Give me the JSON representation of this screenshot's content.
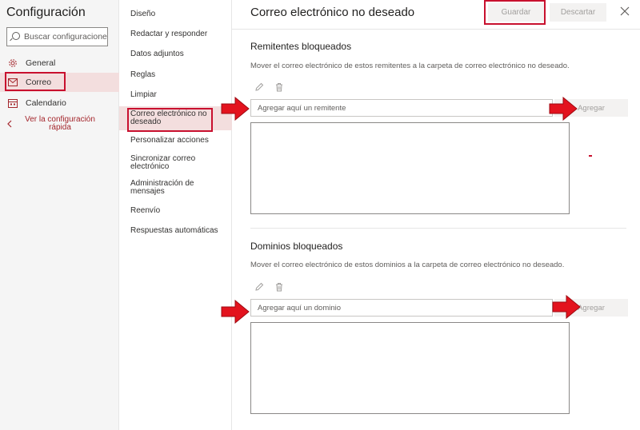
{
  "sidebar": {
    "title": "Configuración",
    "search_placeholder": "Buscar configuraciones",
    "items": [
      {
        "label": "General"
      },
      {
        "label": "Correo"
      },
      {
        "label": "Calendario"
      }
    ],
    "quick_settings": "Ver la configuración rápida"
  },
  "submenu": {
    "items": [
      {
        "label": "Diseño"
      },
      {
        "label": "Redactar y responder"
      },
      {
        "label": "Datos adjuntos"
      },
      {
        "label": "Reglas"
      },
      {
        "label": "Limpiar"
      },
      {
        "label": "Correo electrónico no deseado"
      },
      {
        "label": "Personalizar acciones"
      },
      {
        "label": "Sincronizar correo electrónico"
      },
      {
        "label": "Administración de mensajes"
      },
      {
        "label": "Reenvío"
      },
      {
        "label": "Respuestas automáticas"
      }
    ]
  },
  "main": {
    "title": "Correo electrónico no deseado",
    "save_label": "Guardar",
    "discard_label": "Descartar",
    "blocked_senders": {
      "title": "Remitentes bloqueados",
      "description": "Mover el correo electrónico de estos remitentes a la carpeta de correo electrónico no deseado.",
      "input_placeholder": "Agregar aquí un remitente",
      "add_label": "Agregar"
    },
    "blocked_domains": {
      "title": "Dominios bloqueados",
      "description": "Mover el correo electrónico de estos dominios a la carpeta de correo electrónico no deseado.",
      "input_placeholder": "Agregar aquí un dominio",
      "add_label": "Agregar"
    }
  },
  "colors": {
    "accent": "#a4262c",
    "annotation_red": "#c8102e",
    "selected_bg": "#f3dede"
  },
  "icons": {
    "search": "search-icon",
    "general": "gear-icon",
    "mail": "mail-icon",
    "calendar": "calendar-icon",
    "back": "chevron-left-icon",
    "edit": "pencil-icon",
    "delete": "trash-icon",
    "close": "close-icon"
  }
}
